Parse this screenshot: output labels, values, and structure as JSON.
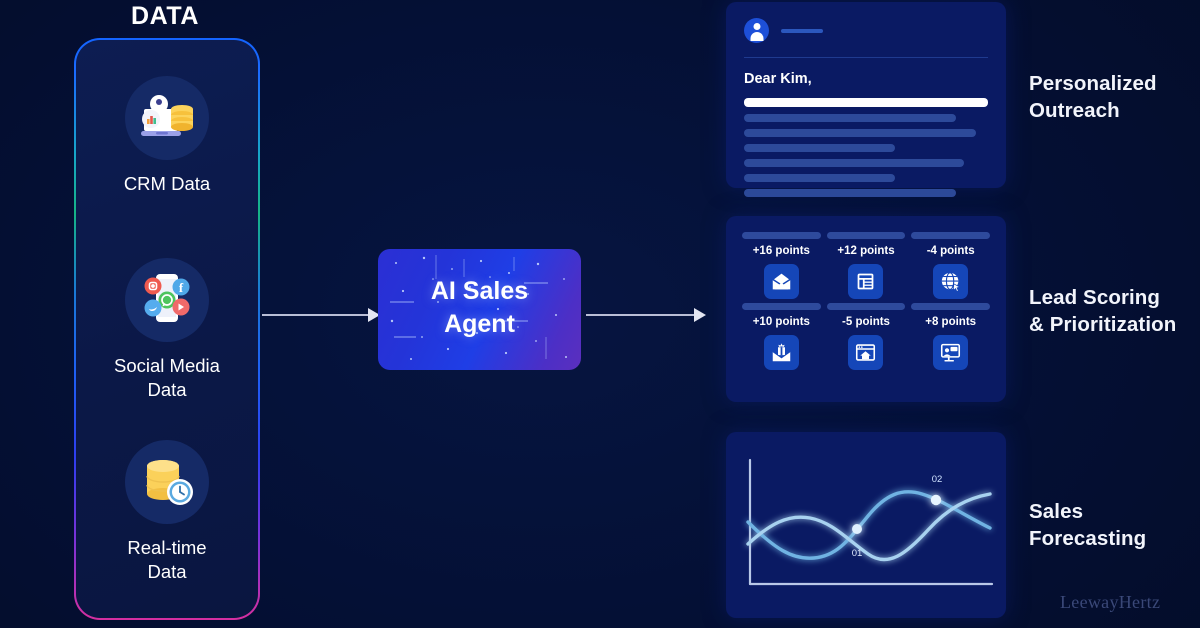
{
  "background_color": "#041035",
  "data_section": {
    "title": "DATA",
    "border_gradient": [
      "#1464ff",
      "#16b486",
      "#1f5ff5",
      "#d62fa0"
    ],
    "items": [
      {
        "label": "CRM Data",
        "icon": "crm-database-laptop-icon"
      },
      {
        "label": "Social Media\nData",
        "label_line1": "Social Media",
        "label_line2": "Data",
        "icon": "social-media-phone-icon"
      },
      {
        "label": "Real-time\nData",
        "label_line1": "Real-time",
        "label_line2": "Data",
        "icon": "realtime-database-clock-icon"
      }
    ]
  },
  "agent": {
    "line1": "AI Sales",
    "line2": "Agent",
    "gradient_from": "#2b2fd4",
    "gradient_to": "#5b2fbe"
  },
  "arrows": {
    "input_arrow": "arrow-data-to-agent",
    "output_arrow": "arrow-agent-to-outputs",
    "color": "#b9bed6"
  },
  "outputs": [
    {
      "id": "personalized-outreach",
      "label_line1": "Personalized",
      "label_line2": "Outreach",
      "card": {
        "type": "email-preview",
        "avatar": "user-avatar-icon",
        "greeting": "Dear Kim,",
        "body_lines": [
          {
            "width_pct": 100,
            "highlight": true
          },
          {
            "width_pct": 87,
            "highlight": false
          },
          {
            "width_pct": 95,
            "highlight": false
          },
          {
            "width_pct": 62,
            "highlight": false
          },
          {
            "width_pct": 90,
            "highlight": false
          },
          {
            "width_pct": 62,
            "highlight": false
          },
          {
            "width_pct": 87,
            "highlight": false
          }
        ]
      }
    },
    {
      "id": "lead-scoring",
      "label_line1": "Lead Scoring",
      "label_line2": "&  Prioritization",
      "card": {
        "type": "score-tiles",
        "tile_color": "#1546b8",
        "tiles": [
          {
            "points": "+16 points",
            "icon": "open-envelope-icon"
          },
          {
            "points": "+12 points",
            "icon": "document-form-icon"
          },
          {
            "points": "-4 points",
            "icon": "globe-cursor-icon"
          },
          {
            "points": "+10 points",
            "icon": "envelope-gift-icon"
          },
          {
            "points": "-5 points",
            "icon": "browser-home-icon"
          },
          {
            "points": "+8 points",
            "icon": "monitor-presentation-icon"
          }
        ]
      }
    },
    {
      "id": "sales-forecasting",
      "label_line1": "Sales",
      "label_line2": "Forecasting",
      "card": {
        "type": "line-chart",
        "point_labels": [
          "01",
          "02"
        ]
      }
    }
  ],
  "chart_data": {
    "type": "line",
    "title": "Sales Forecasting",
    "xlabel": "",
    "ylabel": "",
    "grid": false,
    "legend": "none",
    "axes": {
      "x_axis": true,
      "y_axis": true,
      "ticks": false
    },
    "annotations": [
      {
        "label": "01",
        "x": 0.4,
        "y": 0.43,
        "note": "first crossover point"
      },
      {
        "label": "02",
        "x": 0.745,
        "y": 0.71,
        "note": "second crossover point"
      }
    ],
    "series": [
      {
        "name": "series-a",
        "color": "#79b9e8",
        "x": [
          0.0,
          0.1,
          0.2,
          0.3,
          0.4,
          0.5,
          0.6,
          0.7,
          0.8,
          0.9,
          1.0
        ],
        "y": [
          0.72,
          0.55,
          0.42,
          0.38,
          0.43,
          0.58,
          0.72,
          0.79,
          0.76,
          0.66,
          0.58
        ]
      },
      {
        "name": "series-b",
        "color": "#a8d2f0",
        "x": [
          0.0,
          0.1,
          0.2,
          0.3,
          0.4,
          0.5,
          0.6,
          0.7,
          0.8,
          0.9,
          1.0
        ],
        "y": [
          0.4,
          0.54,
          0.6,
          0.55,
          0.43,
          0.33,
          0.37,
          0.55,
          0.74,
          0.83,
          0.86
        ]
      }
    ]
  },
  "watermark": "LeewayHertz"
}
